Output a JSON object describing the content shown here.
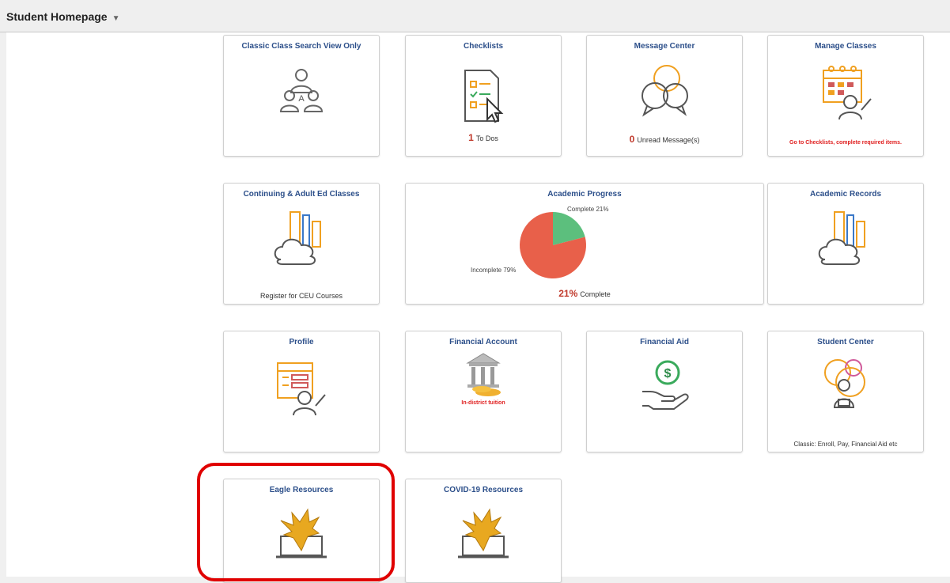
{
  "header": {
    "title": "Student Homepage"
  },
  "tiles": {
    "classic_search": {
      "title": "Classic Class Search View Only"
    },
    "checklists": {
      "title": "Checklists",
      "count": "1",
      "label": "To Dos"
    },
    "message_center": {
      "title": "Message Center",
      "count": "0",
      "label": "Unread Message(s)"
    },
    "manage_classes": {
      "title": "Manage Classes",
      "warning": "Go to Checklists, complete required items."
    },
    "continuing_ed": {
      "title": "Continuing & Adult Ed Classes",
      "footer": "Register for CEU Courses"
    },
    "academic_progress": {
      "title": "Academic Progress",
      "complete_label": "Complete 21%",
      "incomplete_label": "Incomplete 79%",
      "percent": "21%",
      "percent_suffix": "Complete"
    },
    "academic_records": {
      "title": "Academic Records"
    },
    "profile": {
      "title": "Profile"
    },
    "financial_account": {
      "title": "Financial Account",
      "caption": "In-district tuition"
    },
    "financial_aid": {
      "title": "Financial Aid"
    },
    "student_center": {
      "title": "Student Center",
      "footer": "Classic: Enroll, Pay, Financial Aid etc"
    },
    "eagle_resources": {
      "title": "Eagle Resources"
    },
    "covid_resources": {
      "title": "COVID-19 Resources"
    }
  },
  "chart_data": {
    "type": "pie",
    "labels": [
      "Complete",
      "Incomplete"
    ],
    "values": [
      21,
      79
    ],
    "colors": [
      "#5cbf7d",
      "#e8604a"
    ]
  },
  "colors": {
    "title_blue": "#2c4f8a",
    "highlight_red": "#e00000",
    "count_red": "#c0392b"
  }
}
